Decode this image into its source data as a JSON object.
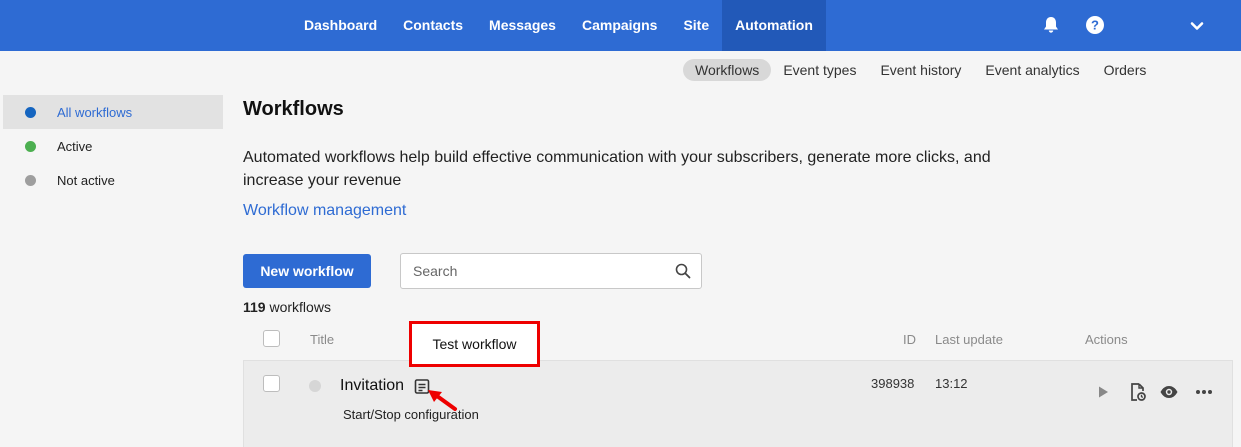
{
  "topnav": {
    "items": [
      {
        "label": "Dashboard"
      },
      {
        "label": "Contacts"
      },
      {
        "label": "Messages"
      },
      {
        "label": "Campaigns"
      },
      {
        "label": "Site"
      },
      {
        "label": "Automation",
        "active": true
      }
    ],
    "icons": [
      "bell-icon",
      "help-icon",
      "chevron-down-icon"
    ]
  },
  "subnav": {
    "items": [
      {
        "label": "Workflows",
        "active": true
      },
      {
        "label": "Event types"
      },
      {
        "label": "Event history"
      },
      {
        "label": "Event analytics"
      },
      {
        "label": "Orders"
      }
    ]
  },
  "sidebar": {
    "items": [
      {
        "label": "All workflows",
        "color": "#1565c0",
        "active": true
      },
      {
        "label": "Active",
        "color": "#4caf50"
      },
      {
        "label": "Not active",
        "color": "#9e9e9e"
      }
    ]
  },
  "main": {
    "title": "Workflows",
    "description": "Automated workflows help build effective communication with your subscribers, generate more clicks, and increase your revenue",
    "management_link": "Workflow management",
    "new_button": "New workflow",
    "search_placeholder": "Search",
    "count_number": "119",
    "count_label": "workflows"
  },
  "table": {
    "headers": {
      "title": "Title",
      "id": "ID",
      "last_update": "Last update",
      "actions": "Actions"
    },
    "rows": [
      {
        "title": "Invitation",
        "subtitle": "Start/Stop configuration",
        "id": "398938",
        "last_update": "13:12"
      }
    ]
  },
  "tooltip": {
    "text": "Test workflow"
  },
  "colors": {
    "brand": "#2e6bd3",
    "highlight": "#e00000"
  }
}
